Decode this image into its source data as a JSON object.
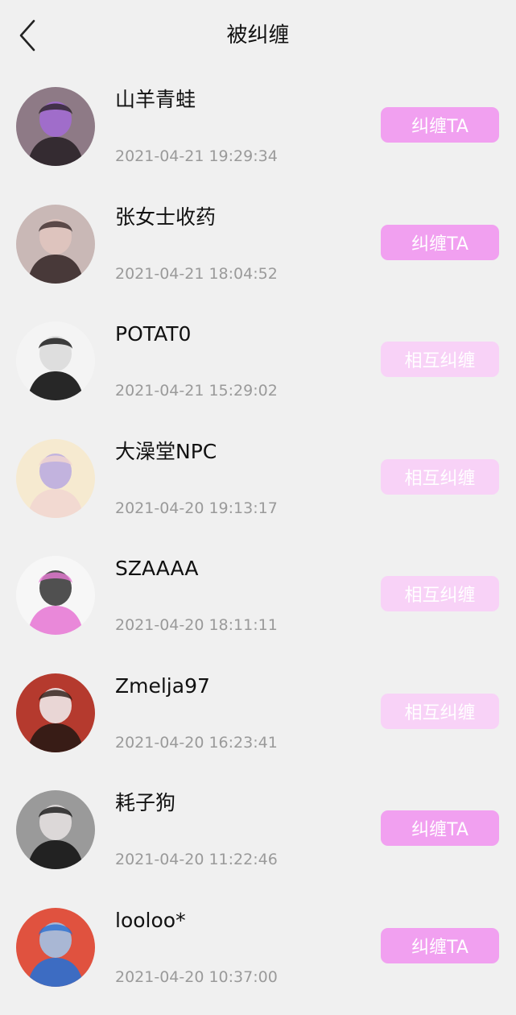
{
  "header": {
    "title": "被纠缠",
    "back_icon": "chevron-left-icon"
  },
  "colors": {
    "background": "#f0f0f0",
    "button_active": "#f1a0f0",
    "button_mutual": "#f8d2f7"
  },
  "items": [
    {
      "name": "山羊青蛙",
      "time": "2021-04-21 19:29:34",
      "button": "纠缠TA",
      "state": "active",
      "avatar_bg": "#8e7a86",
      "avatar_fg": "#2a2228",
      "avatar_accent": "#a36bd6"
    },
    {
      "name": "张女士收药",
      "time": "2021-04-21 18:04:52",
      "button": "纠缠TA",
      "state": "active",
      "avatar_bg": "#c9b8b6",
      "avatar_fg": "#3a2b2b",
      "avatar_accent": "#e2c5c0"
    },
    {
      "name": "POTAT0",
      "time": "2021-04-21 15:29:02",
      "button": "相互纠缠",
      "state": "mutual",
      "avatar_bg": "#f4f4f4",
      "avatar_fg": "#111111",
      "avatar_accent": "#d9d9d9"
    },
    {
      "name": "大澡堂NPC",
      "time": "2021-04-20 19:13:17",
      "button": "相互纠缠",
      "state": "mutual",
      "avatar_bg": "#f6ead0",
      "avatar_fg": "#f2d7d0",
      "avatar_accent": "#b8a9e0"
    },
    {
      "name": "SZAAAA",
      "time": "2021-04-20 18:11:11",
      "button": "相互纠缠",
      "state": "mutual",
      "avatar_bg": "#f7f7f7",
      "avatar_fg": "#e77bd5",
      "avatar_accent": "#333333"
    },
    {
      "name": "Zmelja97",
      "time": "2021-04-20 16:23:41",
      "button": "相互纠缠",
      "state": "mutual",
      "avatar_bg": "#b53a2e",
      "avatar_fg": "#2a1a14",
      "avatar_accent": "#f2f2f2"
    },
    {
      "name": "耗子狗",
      "time": "2021-04-20 11:22:46",
      "button": "纠缠TA",
      "state": "active",
      "avatar_bg": "#9a9a9a",
      "avatar_fg": "#151515",
      "avatar_accent": "#e8e3e3"
    },
    {
      "name": "looloo*",
      "time": "2021-04-20 10:37:00",
      "button": "纠缠TA",
      "state": "active",
      "avatar_bg": "#e0523f",
      "avatar_fg": "#2b6fd0",
      "avatar_accent": "#9fc9ef"
    }
  ]
}
